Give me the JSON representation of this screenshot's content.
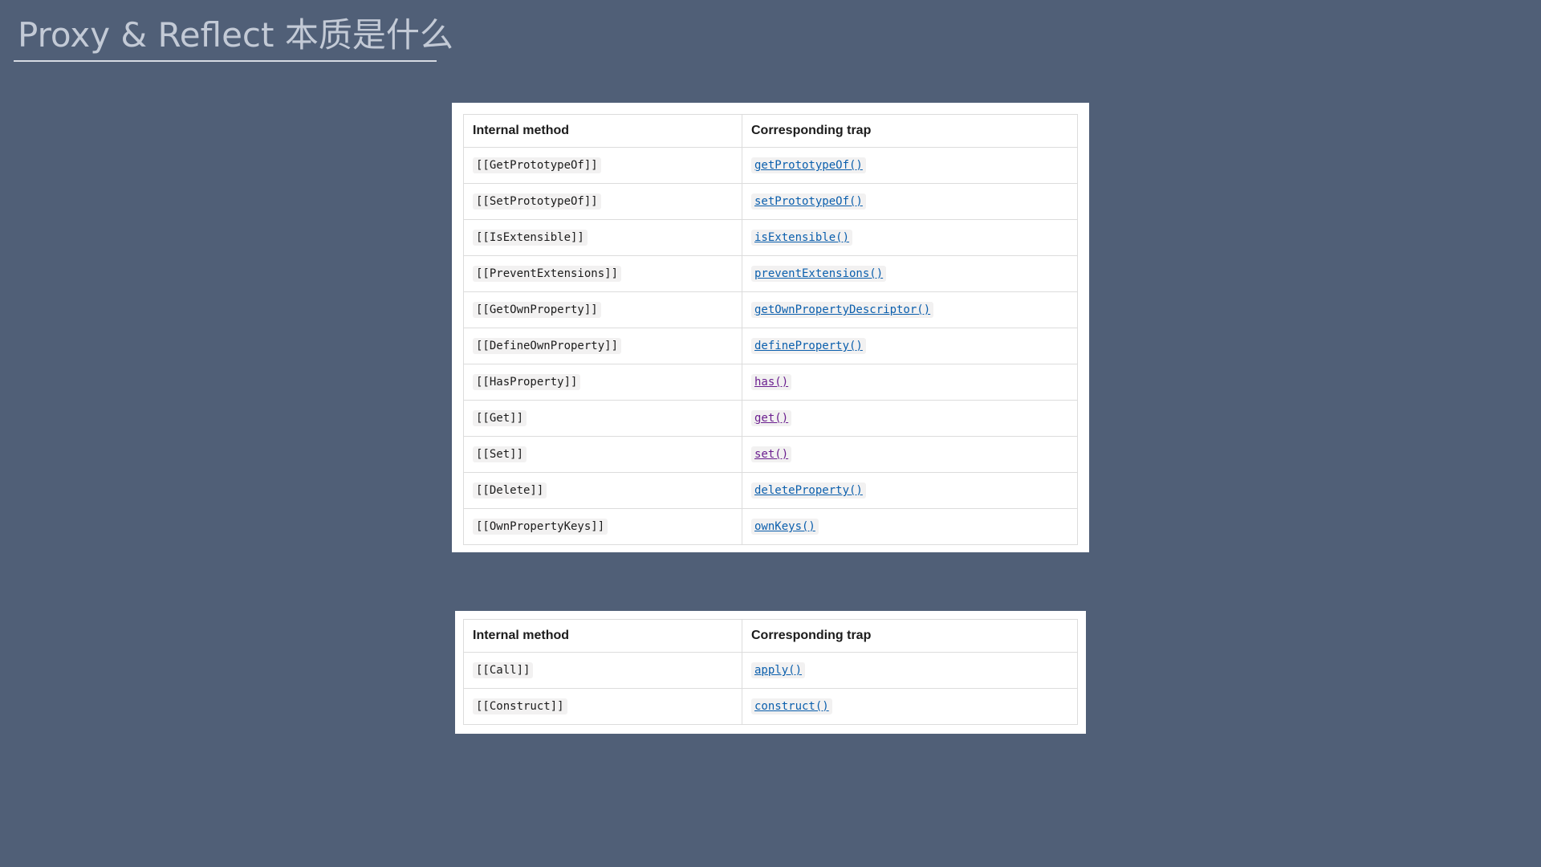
{
  "slide": {
    "title": "Proxy & Reflect 本质是什么"
  },
  "colors": {
    "background": "#505f77",
    "link": "#0b5fad",
    "link_visited": "#6b1f8f"
  },
  "table_main": {
    "headers": [
      "Internal method",
      "Corresponding trap"
    ],
    "rows": [
      {
        "method": "[[GetPrototypeOf]]",
        "trap": "getPrototypeOf()",
        "visited": false
      },
      {
        "method": "[[SetPrototypeOf]]",
        "trap": "setPrototypeOf()",
        "visited": false
      },
      {
        "method": "[[IsExtensible]]",
        "trap": "isExtensible()",
        "visited": false
      },
      {
        "method": "[[PreventExtensions]]",
        "trap": "preventExtensions()",
        "visited": false
      },
      {
        "method": "[[GetOwnProperty]]",
        "trap": "getOwnPropertyDescriptor()",
        "visited": false
      },
      {
        "method": "[[DefineOwnProperty]]",
        "trap": "defineProperty()",
        "visited": false
      },
      {
        "method": "[[HasProperty]]",
        "trap": "has()",
        "visited": true
      },
      {
        "method": "[[Get]]",
        "trap": "get()",
        "visited": true
      },
      {
        "method": "[[Set]]",
        "trap": "set()",
        "visited": true
      },
      {
        "method": "[[Delete]]",
        "trap": "deleteProperty()",
        "visited": false
      },
      {
        "method": "[[OwnPropertyKeys]]",
        "trap": "ownKeys()",
        "visited": false
      }
    ]
  },
  "table_call": {
    "headers": [
      "Internal method",
      "Corresponding trap"
    ],
    "rows": [
      {
        "method": "[[Call]]",
        "trap": "apply()",
        "visited": false
      },
      {
        "method": "[[Construct]]",
        "trap": "construct()",
        "visited": false
      }
    ]
  }
}
